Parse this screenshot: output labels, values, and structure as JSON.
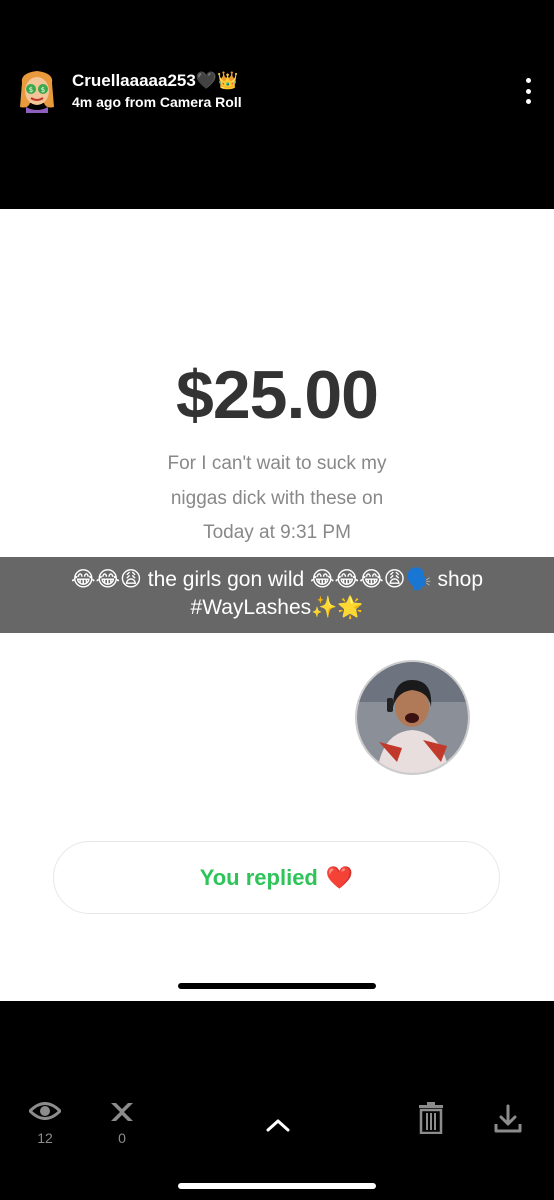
{
  "header": {
    "username": "Cruellaaaaa253🖤👑",
    "meta": "4m ago from Camera Roll"
  },
  "story": {
    "amount": "$25.00",
    "note_line1": "For I can't wait to suck my",
    "note_line2": "niggas dick with these on",
    "time": "Today at 9:31 PM",
    "caption_line1": "😂😂😩 the girls gon wild 😂😂😂😩🗣️ shop",
    "caption_line2": "#WayLashes✨🌟",
    "reply_label": "You replied",
    "reply_emoji": "❤️"
  },
  "footer": {
    "views": "12",
    "screenshots": "0"
  },
  "icons": {
    "avatar": "bitmoji-avatar-icon",
    "more": "more-vertical-icon",
    "views": "eye-icon",
    "screenshots": "screenshot-icon",
    "up": "chevron-up-icon",
    "delete": "trash-icon",
    "download": "download-icon"
  },
  "colors": {
    "reply_green": "#2ec45a",
    "caption_bg": "#464646"
  }
}
